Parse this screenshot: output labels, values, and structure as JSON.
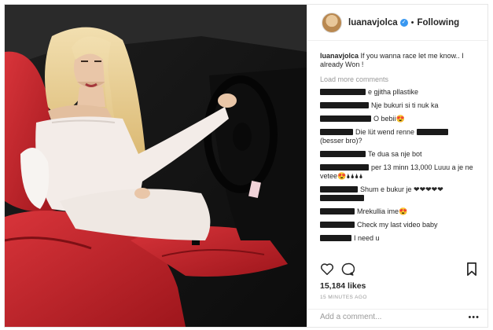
{
  "post": {
    "username": "luanavjolca",
    "follow_label": "Following",
    "separator": "•",
    "verified_glyph": "✓"
  },
  "caption": {
    "username": "luanavjolca",
    "text": "If you wanna race let me know.. I already Won !"
  },
  "load_more": "Load more comments",
  "comments": [
    {
      "text": "e gjitha pllastike"
    },
    {
      "text": "Nje bukuri si ti nuk ka"
    },
    {
      "text": "O bebii😍"
    },
    {
      "text": "Die lüt wend renne"
    },
    {
      "text": "(besser bro)?"
    },
    {
      "text": "Te dua sa nje bot"
    },
    {
      "text": "per 13 minn 13,000 Luuu a je ne vetee😍🌢🌢🌢🌢"
    },
    {
      "text": "Shum e bukur je ❤❤❤❤❤"
    },
    {
      "text": "Mrekullia ime😍"
    },
    {
      "text": "Check my last video baby"
    },
    {
      "text": "I need u"
    }
  ],
  "likes": "15,184 likes",
  "timestamp": "15 MINUTES AGO",
  "add_comment_placeholder": "Add a comment...",
  "more_options": "•••",
  "icons": [
    "heart-icon",
    "comment-icon",
    "bookmark-icon"
  ],
  "colors": {
    "verified": "#3897f0",
    "seat_red": "#c8252b",
    "text": "#262626",
    "muted": "#999999"
  }
}
